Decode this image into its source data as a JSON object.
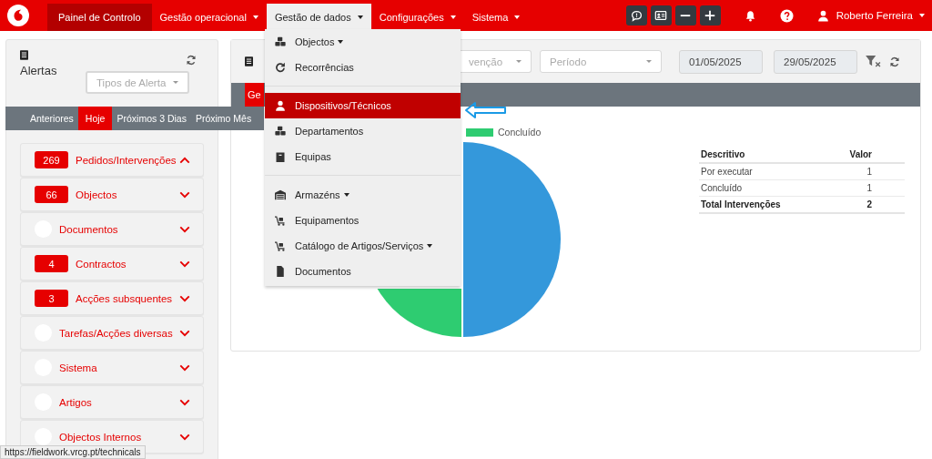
{
  "navbar": {
    "items": [
      {
        "label": "Painel de Controlo",
        "active": true,
        "open": false,
        "has_menu": false
      },
      {
        "label": "Gestão operacional",
        "active": false,
        "open": false,
        "has_menu": true
      },
      {
        "label": "Gestão de dados",
        "active": false,
        "open": true,
        "has_menu": true
      },
      {
        "label": "Configurações",
        "active": false,
        "open": false,
        "has_menu": true
      },
      {
        "label": "Sistema",
        "active": false,
        "open": false,
        "has_menu": true
      }
    ],
    "user": "Roberto Ferreira"
  },
  "data_menu": {
    "groups": [
      [
        {
          "label": "Objectos",
          "has_submenu": true,
          "selected": false
        },
        {
          "label": "Recorrências",
          "has_submenu": false,
          "selected": false
        }
      ],
      [
        {
          "label": "Dispositivos/Técnicos",
          "has_submenu": false,
          "selected": true
        },
        {
          "label": "Departamentos",
          "has_submenu": false,
          "selected": false
        },
        {
          "label": "Equipas",
          "has_submenu": false,
          "selected": false
        }
      ],
      [
        {
          "label": "Armazéns",
          "has_submenu": true,
          "selected": false
        },
        {
          "label": "Equipamentos",
          "has_submenu": false,
          "selected": false
        },
        {
          "label": "Catálogo de Artigos/Serviços",
          "has_submenu": true,
          "selected": false
        },
        {
          "label": "Documentos",
          "has_submenu": false,
          "selected": false
        }
      ]
    ]
  },
  "alerts": {
    "title": "Alertas",
    "type_select": {
      "placeholder": "Tipos de Alerta"
    },
    "tabs": [
      {
        "label": "Anteriores",
        "selected": false
      },
      {
        "label": "Hoje",
        "selected": true
      },
      {
        "label": "Próximos 3 Dias",
        "selected": false
      },
      {
        "label": "Próximo Mês",
        "selected": false
      }
    ],
    "groups": [
      {
        "badge": "269",
        "label": "Pedidos/Intervenções",
        "expanded": true
      },
      {
        "badge": "66",
        "label": "Objectos",
        "expanded": false
      },
      {
        "label": "Documentos",
        "expanded": false
      },
      {
        "badge": "4",
        "label": "Contractos",
        "expanded": false
      },
      {
        "badge": "3",
        "label": "Acções subsquentes",
        "expanded": false
      },
      {
        "label": "Tarefas/Acções diversas",
        "expanded": false
      },
      {
        "label": "Sistema",
        "expanded": false
      },
      {
        "label": "Artigos",
        "expanded": false
      },
      {
        "label": "Objectos Internos",
        "expanded": false
      }
    ]
  },
  "dashboard": {
    "filters": {
      "type_select": {
        "placeholder": "venção"
      },
      "period_select": {
        "placeholder": "Período"
      },
      "date_from": "01/05/2025",
      "date_to": "29/05/2025"
    },
    "tabs": [
      {
        "label": "Ge",
        "selected": true
      }
    ],
    "legend": [
      {
        "label": "Concluído",
        "color": "#2ecc71"
      }
    ],
    "table": {
      "columns": [
        "Descritivo",
        "Valor"
      ],
      "rows": [
        {
          "label": "Por executar",
          "value": "1",
          "kind": "row"
        },
        {
          "label": "Concluído",
          "value": "1",
          "kind": "row"
        },
        {
          "label": "Total Intervenções",
          "value": "2",
          "kind": "total"
        }
      ]
    }
  },
  "status_url": "https://fieldwork.vrcg.pt/technicals"
}
